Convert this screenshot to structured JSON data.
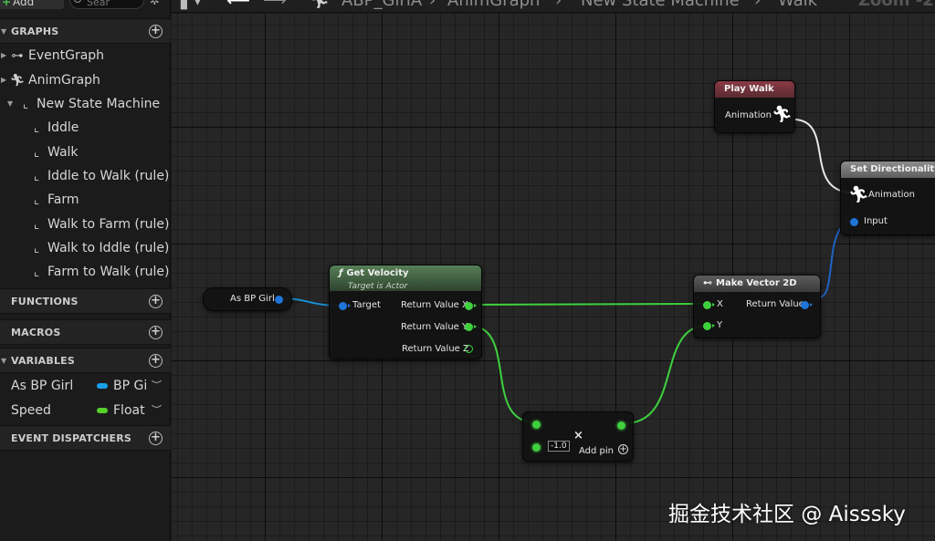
{
  "toolbar": {
    "add_label": "Add",
    "search_placeholder": "Sear"
  },
  "breadcrumb": {
    "blueprint": "ABP_GirlA",
    "graph": "AnimGraph",
    "state_machine": "New State Machine",
    "state": "Walk",
    "zoom": "Zoom -2"
  },
  "sections": {
    "graphs": "GRAPHS",
    "functions": "FUNCTIONS",
    "macros": "MACROS",
    "variables": "VARIABLES",
    "event_dispatchers": "EVENT DISPATCHERS"
  },
  "graphs_tree": {
    "event_graph": "EventGraph",
    "anim_graph": "AnimGraph",
    "state_machine": "New State Machine",
    "states": [
      "Iddle",
      "Walk",
      "Iddle to Walk (rule)",
      "Farm",
      "Walk to Farm (rule)",
      "Walk to Iddle (rule)",
      "Farm to Walk (rule)"
    ]
  },
  "variables": [
    {
      "name": "As BP Girl",
      "type": "BP Gi",
      "color": "#1aa0e8"
    },
    {
      "name": "Speed",
      "type": "Float",
      "color": "#55d12a"
    }
  ],
  "nodes": {
    "play_walk": {
      "title": "Play Walk",
      "pin_animation": "Animation",
      "header_color": "#8a3a45"
    },
    "set_directionality": {
      "title": "Set Directionality",
      "pin_animation": "Animation",
      "pin_input": "Input",
      "header_color": "#7d7d7d"
    },
    "as_bp_girl": {
      "title": "As BP Girl"
    },
    "get_velocity": {
      "title": "Get Velocity",
      "subtitle": "Target is Actor",
      "pin_target": "Target",
      "out_x": "Return Value X",
      "out_y": "Return Value Y",
      "out_z": "Return Value Z",
      "header_color": "#4e7a4e"
    },
    "make_vector_2d": {
      "title": "Make Vector 2D",
      "pin_x": "X",
      "pin_y": "Y",
      "out": "Return Value",
      "header_color": "#4d4d4d"
    },
    "multiply": {
      "symbol": "×",
      "value": "-1.0",
      "add_pin": "Add pin"
    }
  },
  "watermark": "掘金技术社区 @ Aisssky"
}
